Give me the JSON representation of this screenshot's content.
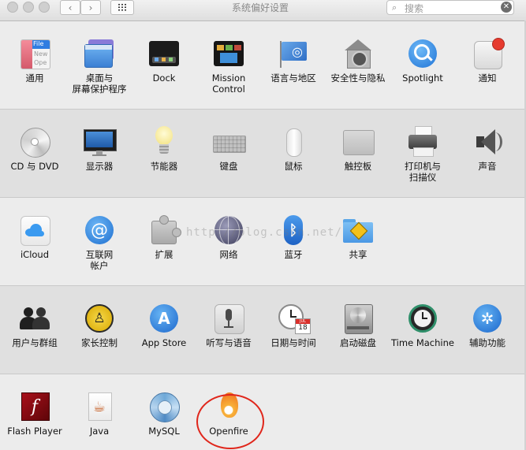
{
  "window": {
    "title": "系统偏好设置"
  },
  "toolbar": {
    "back_icon": "chevron-left-icon",
    "forward_icon": "chevron-right-icon",
    "show_all_icon": "grid-icon",
    "search_placeholder": "搜索",
    "clear_icon": "clear-icon"
  },
  "watermark": "http://blog.csdn.net/",
  "colors": {
    "highlight_ring": "#e0261b",
    "toolbar_bg": "#e8e8e8",
    "section_dark_bg": "#e0e0e0"
  },
  "sections": [
    {
      "items": [
        {
          "label": "通用",
          "icon": "general-icon"
        },
        {
          "label": "桌面与\n屏幕保护程序",
          "icon": "desktop-screensaver-icon"
        },
        {
          "label": "Dock",
          "icon": "dock-icon"
        },
        {
          "label": "Mission\nControl",
          "icon": "mission-control-icon"
        },
        {
          "label": "语言与地区",
          "icon": "language-region-icon"
        },
        {
          "label": "安全性与隐私",
          "icon": "security-privacy-icon"
        },
        {
          "label": "Spotlight",
          "icon": "spotlight-icon"
        },
        {
          "label": "通知",
          "icon": "notifications-icon"
        }
      ]
    },
    {
      "items": [
        {
          "label": "CD 与 DVD",
          "icon": "cd-dvd-icon"
        },
        {
          "label": "显示器",
          "icon": "displays-icon"
        },
        {
          "label": "节能器",
          "icon": "energy-saver-icon"
        },
        {
          "label": "键盘",
          "icon": "keyboard-icon"
        },
        {
          "label": "鼠标",
          "icon": "mouse-icon"
        },
        {
          "label": "触控板",
          "icon": "trackpad-icon"
        },
        {
          "label": "打印机与\n扫描仪",
          "icon": "printer-scanner-icon"
        },
        {
          "label": "声音",
          "icon": "sound-icon"
        }
      ]
    },
    {
      "items": [
        {
          "label": "iCloud",
          "icon": "icloud-icon"
        },
        {
          "label": "互联网\n帐户",
          "icon": "internet-accounts-icon"
        },
        {
          "label": "扩展",
          "icon": "extensions-icon"
        },
        {
          "label": "网络",
          "icon": "network-icon"
        },
        {
          "label": "蓝牙",
          "icon": "bluetooth-icon"
        },
        {
          "label": "共享",
          "icon": "sharing-icon"
        }
      ]
    },
    {
      "items": [
        {
          "label": "用户与群组",
          "icon": "users-groups-icon"
        },
        {
          "label": "家长控制",
          "icon": "parental-controls-icon"
        },
        {
          "label": "App Store",
          "icon": "app-store-icon"
        },
        {
          "label": "听写与语音",
          "icon": "dictation-speech-icon"
        },
        {
          "label": "日期与时间",
          "icon": "date-time-icon"
        },
        {
          "label": "启动磁盘",
          "icon": "startup-disk-icon"
        },
        {
          "label": "Time Machine",
          "icon": "time-machine-icon"
        },
        {
          "label": "辅助功能",
          "icon": "accessibility-icon"
        }
      ]
    },
    {
      "items": [
        {
          "label": "Flash Player",
          "icon": "flash-player-icon"
        },
        {
          "label": "Java",
          "icon": "java-icon"
        },
        {
          "label": "MySQL",
          "icon": "mysql-icon"
        },
        {
          "label": "Openfire",
          "icon": "openfire-icon"
        }
      ]
    }
  ],
  "icon_glyphs": {
    "calendar_month": "JUL",
    "calendar_day": "18",
    "file_icon_text": "File",
    "file_icon_text2": "New",
    "file_icon_text3": "Ope"
  }
}
